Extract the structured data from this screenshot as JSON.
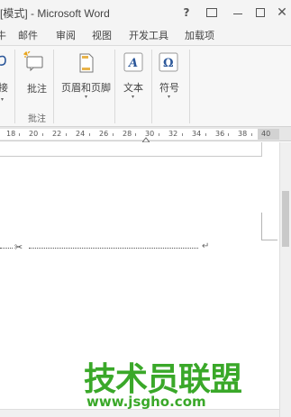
{
  "window": {
    "title": "[模式] - Microsoft Word",
    "help": "?",
    "close": "✕"
  },
  "tabs": [
    "邮件",
    "审阅",
    "视图",
    "开发工具",
    "加载项"
  ],
  "ribbon": {
    "partial_left_label": "接",
    "comment_label": "批注",
    "comment_group_label": "批注",
    "header_footer_label": "页眉和页脚",
    "text_label": "文本",
    "symbol_label": "符号",
    "caret": "▾"
  },
  "ruler": {
    "ticks": [
      "18",
      "20",
      "22",
      "24",
      "26",
      "28",
      "30",
      "32",
      "34",
      "36",
      "38",
      "40"
    ]
  },
  "document": {
    "scissors": "✂",
    "paragraph_mark": "↵"
  },
  "watermark": {
    "brand": "技术员联盟",
    "url": "www.jsgho.com"
  },
  "colors": {
    "accent": "#2b579a",
    "watermark": "#3aa829"
  }
}
